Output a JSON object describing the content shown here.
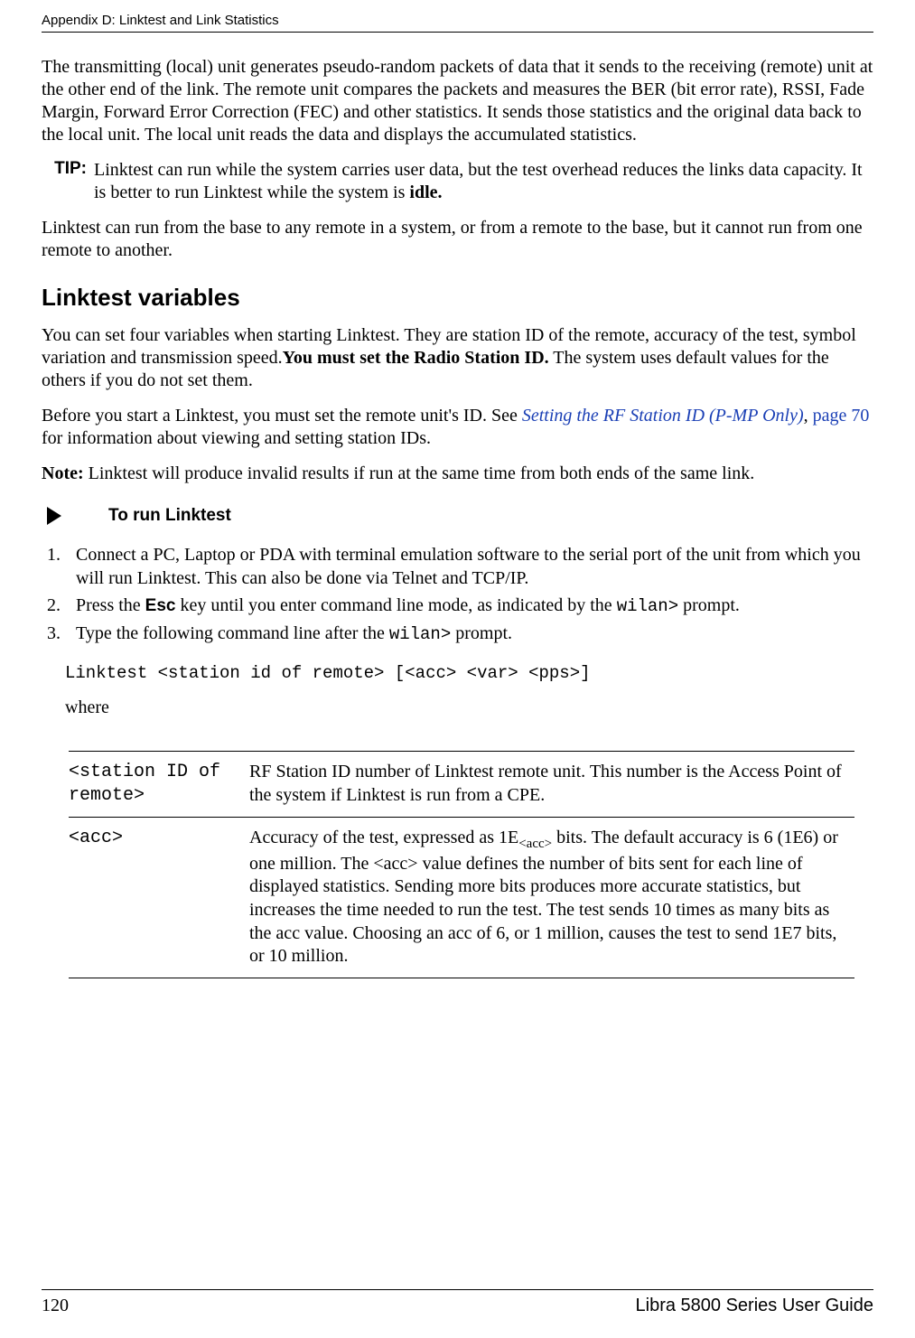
{
  "header": {
    "title": "Appendix D: Linktest and Link Statistics"
  },
  "body": {
    "p1": "The transmitting (local) unit generates pseudo-random packets of data that it sends to the receiving (remote) unit at the other end of the link. The remote unit compares the packets and measures the BER (bit error rate), RSSI, Fade Margin, Forward Error Correction (FEC) and other statistics. It sends those statistics and the original data back to the local unit. The local unit reads the data and displays the accumulated statistics.",
    "tip": {
      "label": "TIP:",
      "text_a": "Linktest can run while the system carries user data, but the test overhead reduces the links data capacity. It is better to run Linktest while the system is ",
      "text_b": "idle."
    },
    "p2": "Linktest can run from the base to any remote in a system, or from a remote to the base, but it cannot run from one remote to another.",
    "h2": "Linktest variables",
    "p3_a": "You can set four variables when starting Linktest. They are station ID of the remote, accuracy of the test, symbol variation and transmission speed.",
    "p3_b": "You must set the Radio Station ID.",
    "p3_c": " The system uses default values for the others if you do not set them.",
    "p4_a": "Before you start a Linktest, you must set the remote unit's ID. See ",
    "p4_link1": "Setting the RF Station ID (P-MP Only)",
    "p4_b": ", ",
    "p4_link2": "page 70",
    "p4_c": " for information about viewing and setting station IDs.",
    "note_label": "Note:",
    "note_text": " Linktest will produce invalid results if run at the same time from both ends of the same link.",
    "proc_title": "To run Linktest",
    "steps": {
      "s1": "Connect a PC, Laptop or PDA with terminal emulation software to the serial port of the unit from which you will run Linktest. This can also be done via Telnet and TCP/IP.",
      "s2_a": "Press the ",
      "s2_b": "Esc",
      "s2_c": " key until you enter command line mode, as indicated by the ",
      "s2_d": "wilan>",
      "s2_e": " prompt.",
      "s3_a": "Type the following command line after the ",
      "s3_b": "wilan>",
      "s3_c": "  prompt."
    },
    "cmd": "Linktest <station id of remote> [<acc> <var> <pps>]",
    "where": "where",
    "table": {
      "r1": {
        "name": "<station ID of remote>",
        "desc": "RF Station ID number of Linktest remote unit. This number is the Access Point of the system if Linktest is run from a CPE."
      },
      "r2": {
        "name": "<acc>",
        "desc_a": "Accuracy of the test, expressed as 1E",
        "desc_b": "<acc>",
        "desc_c": " bits. The default accuracy is 6 (1E6) or one million. The <acc> value defines the number of bits sent for each line of displayed statistics. Sending more bits produces more accurate statistics, but increases the time needed to run the test. The test sends 10 times as many bits as the acc value. Choosing an acc of 6, or 1 million, causes the test to send 1E7 bits, or 10 million."
      }
    }
  },
  "footer": {
    "page": "120",
    "title": "Libra 5800 Series User Guide"
  }
}
